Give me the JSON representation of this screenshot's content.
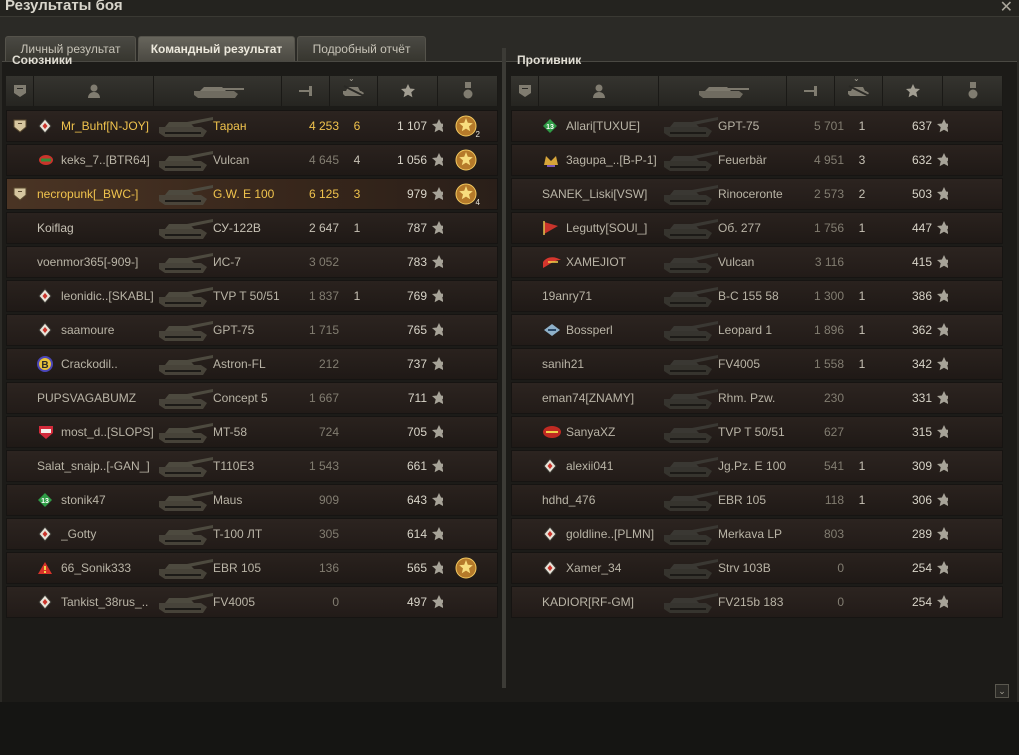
{
  "window": {
    "title": "Результаты боя"
  },
  "tabs": [
    {
      "label": "Личный результат"
    },
    {
      "label": "Командный результат"
    },
    {
      "label": "Подробный отчёт"
    }
  ],
  "allies": {
    "title": "Союзники",
    "rows": [
      {
        "name": "Mr_Buhf[N-JOY]",
        "tank": "Таран",
        "damage": "4 253",
        "kills": "6",
        "xp": "1 107",
        "highlight": true,
        "rank_badge": true,
        "clan_icon": "diamond",
        "medal": true,
        "medal_count": "2"
      },
      {
        "name": "keks_7..[BTR64]",
        "tank": "Vulcan",
        "damage": "4 645",
        "kills": "4",
        "xp": "1 056",
        "clan_icon": "cup",
        "medal": true
      },
      {
        "name": "necropunk[_BWC-]",
        "tank": "G.W. E 100",
        "damage": "6 125",
        "kills": "3",
        "xp": "979",
        "highlight": true,
        "player": true,
        "rank_badge": true,
        "medal": true,
        "medal_count": "4"
      },
      {
        "name": "Koiflag",
        "tank": "СУ-122В",
        "damage": "2 647",
        "kills": "1",
        "xp": "787",
        "bright": true
      },
      {
        "name": "voenmor365[-909-]",
        "tank": "ИС-7",
        "damage": "3 052",
        "kills": "",
        "xp": "783"
      },
      {
        "name": "leonidic..[SKABL]",
        "tank": "TVP T 50/51",
        "damage": "1 837",
        "kills": "1",
        "xp": "769",
        "clan_icon": "diamond"
      },
      {
        "name": "saamoure",
        "tank": "GPT-75",
        "damage": "1 715",
        "kills": "",
        "xp": "765",
        "clan_icon": "diamond"
      },
      {
        "name": "Crackodil..",
        "tank": "Astron-FL",
        "damage": "212",
        "kills": "",
        "xp": "737",
        "clan_icon": "b-circle"
      },
      {
        "name": "PUPSVAGABUMZ",
        "tank": "Concept 5",
        "damage": "1 667",
        "kills": "",
        "xp": "711"
      },
      {
        "name": "most_d..[SLOPS]",
        "tank": "MT-58",
        "damage": "724",
        "kills": "",
        "xp": "705",
        "clan_icon": "shield"
      },
      {
        "name": "Salat_snajp..[-GAN_]",
        "tank": "T110E3",
        "damage": "1 543",
        "kills": "",
        "xp": "661"
      },
      {
        "name": "stonik47",
        "tank": "Maus",
        "damage": "909",
        "kills": "",
        "xp": "643",
        "clan_icon": "green13"
      },
      {
        "name": "_Gotty",
        "tank": "T-100 ЛТ",
        "damage": "305",
        "kills": "",
        "xp": "614",
        "clan_icon": "diamond"
      },
      {
        "name": "66_Sonik333",
        "tank": "EBR 105",
        "damage": "136",
        "kills": "",
        "xp": "565",
        "clan_icon": "triangle",
        "medal": true
      },
      {
        "name": "Tankist_38rus_..",
        "tank": "FV4005",
        "damage": "0",
        "kills": "",
        "xp": "497",
        "clan_icon": "diamond"
      }
    ]
  },
  "enemies": {
    "title": "Противник",
    "rows": [
      {
        "name": "Allari[TUXUE]",
        "tank": "GPT-75",
        "damage": "5 701",
        "kills": "1",
        "xp": "637",
        "clan_icon": "green13"
      },
      {
        "name": "3agupa_..[B-P-1]",
        "tank": "Feuerbär",
        "damage": "4 951",
        "kills": "3",
        "xp": "632",
        "clan_icon": "crown"
      },
      {
        "name": "SANEK_Liski[VSW]",
        "tank": "Rinoceronte",
        "damage": "2 573",
        "kills": "2",
        "xp": "503"
      },
      {
        "name": "Legutty[SOUl_]",
        "tank": "Об. 277",
        "damage": "1 756",
        "kills": "1",
        "xp": "447",
        "clan_icon": "flag"
      },
      {
        "name": "XAMEJIOT",
        "tank": "Vulcan",
        "damage": "3 116",
        "kills": "",
        "xp": "415",
        "clan_icon": "wing"
      },
      {
        "name": "19anry71",
        "tank": "B-C 155 58",
        "damage": "1 300",
        "kills": "1",
        "xp": "386"
      },
      {
        "name": "Bossperl",
        "tank": "Leopard 1",
        "damage": "1 896",
        "kills": "1",
        "xp": "362",
        "clan_icon": "gun"
      },
      {
        "name": "sanih21",
        "tank": "FV4005",
        "damage": "1 558",
        "kills": "1",
        "xp": "342"
      },
      {
        "name": "eman74[ZNAMY]",
        "tank": "Rhm. Pzw.",
        "damage": "230",
        "kills": "",
        "xp": "331"
      },
      {
        "name": "SanyaXZ",
        "tank": "TVP T 50/51",
        "damage": "627",
        "kills": "",
        "xp": "315",
        "clan_icon": "red"
      },
      {
        "name": "alexii041",
        "tank": "Jg.Pz. E 100",
        "damage": "541",
        "kills": "1",
        "xp": "309",
        "clan_icon": "diamond"
      },
      {
        "name": "hdhd_476",
        "tank": "EBR 105",
        "damage": "118",
        "kills": "1",
        "xp": "306"
      },
      {
        "name": "goldline..[PLMN]",
        "tank": "Merkava LP",
        "damage": "803",
        "kills": "",
        "xp": "289",
        "clan_icon": "diamond"
      },
      {
        "name": "Xamer_34",
        "tank": "Strv 103B",
        "damage": "0",
        "kills": "",
        "xp": "254",
        "clan_icon": "diamond"
      },
      {
        "name": "KADIOR[RF-GM]",
        "tank": "FV215b 183",
        "damage": "0",
        "kills": "",
        "xp": "254"
      }
    ]
  },
  "colors": {
    "highlight": "#f0c34d",
    "player_row": "#4a3424",
    "star": "#a7a398"
  },
  "icons": {
    "header": [
      "platoon-icon",
      "player-icon",
      "tank-icon",
      "damage-icon",
      "kills-icon",
      "xp-star-icon",
      "medal-icon"
    ],
    "star_glyph": "★"
  },
  "sort": {
    "column": "xp",
    "indicator": "⌄"
  }
}
